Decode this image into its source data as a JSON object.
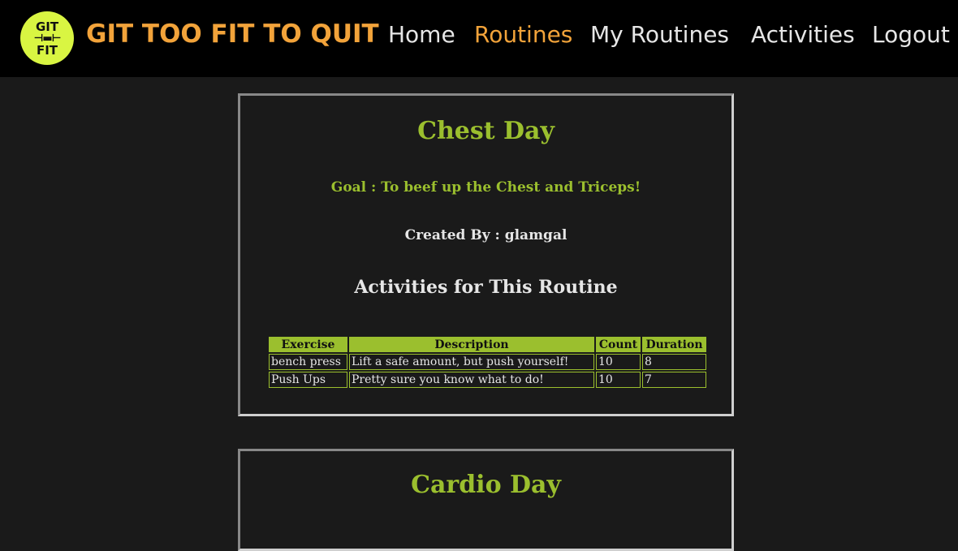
{
  "nav": {
    "logo_top": "GIT",
    "logo_mid": "⊣▬⊢",
    "logo_bottom": "FIT",
    "brand": "GIT TOO FIT TO QUIT",
    "links": [
      "Home",
      "Routines",
      "My Routines",
      "Activities",
      "Logout"
    ],
    "active": "Routines"
  },
  "routines": [
    {
      "title": "Chest Day",
      "goal": "Goal : To beef up the Chest and Triceps!",
      "creator": "Created By : glamgal",
      "activities_heading": "Activities for This Routine",
      "columns": [
        "Exercise",
        "Description",
        "Count",
        "Duration"
      ],
      "rows": [
        [
          "bench press",
          "Lift a safe amount, but push yourself!",
          "10",
          "8"
        ],
        [
          "Push Ups",
          "Pretty sure you know what to do!",
          "10",
          "7"
        ]
      ]
    },
    {
      "title": "Cardio Day"
    }
  ],
  "colors": {
    "accent_orange": "#f2a33a",
    "accent_green": "#9bbf2e",
    "logo_yellow": "#d9f542",
    "background": "#1a1a1a"
  }
}
